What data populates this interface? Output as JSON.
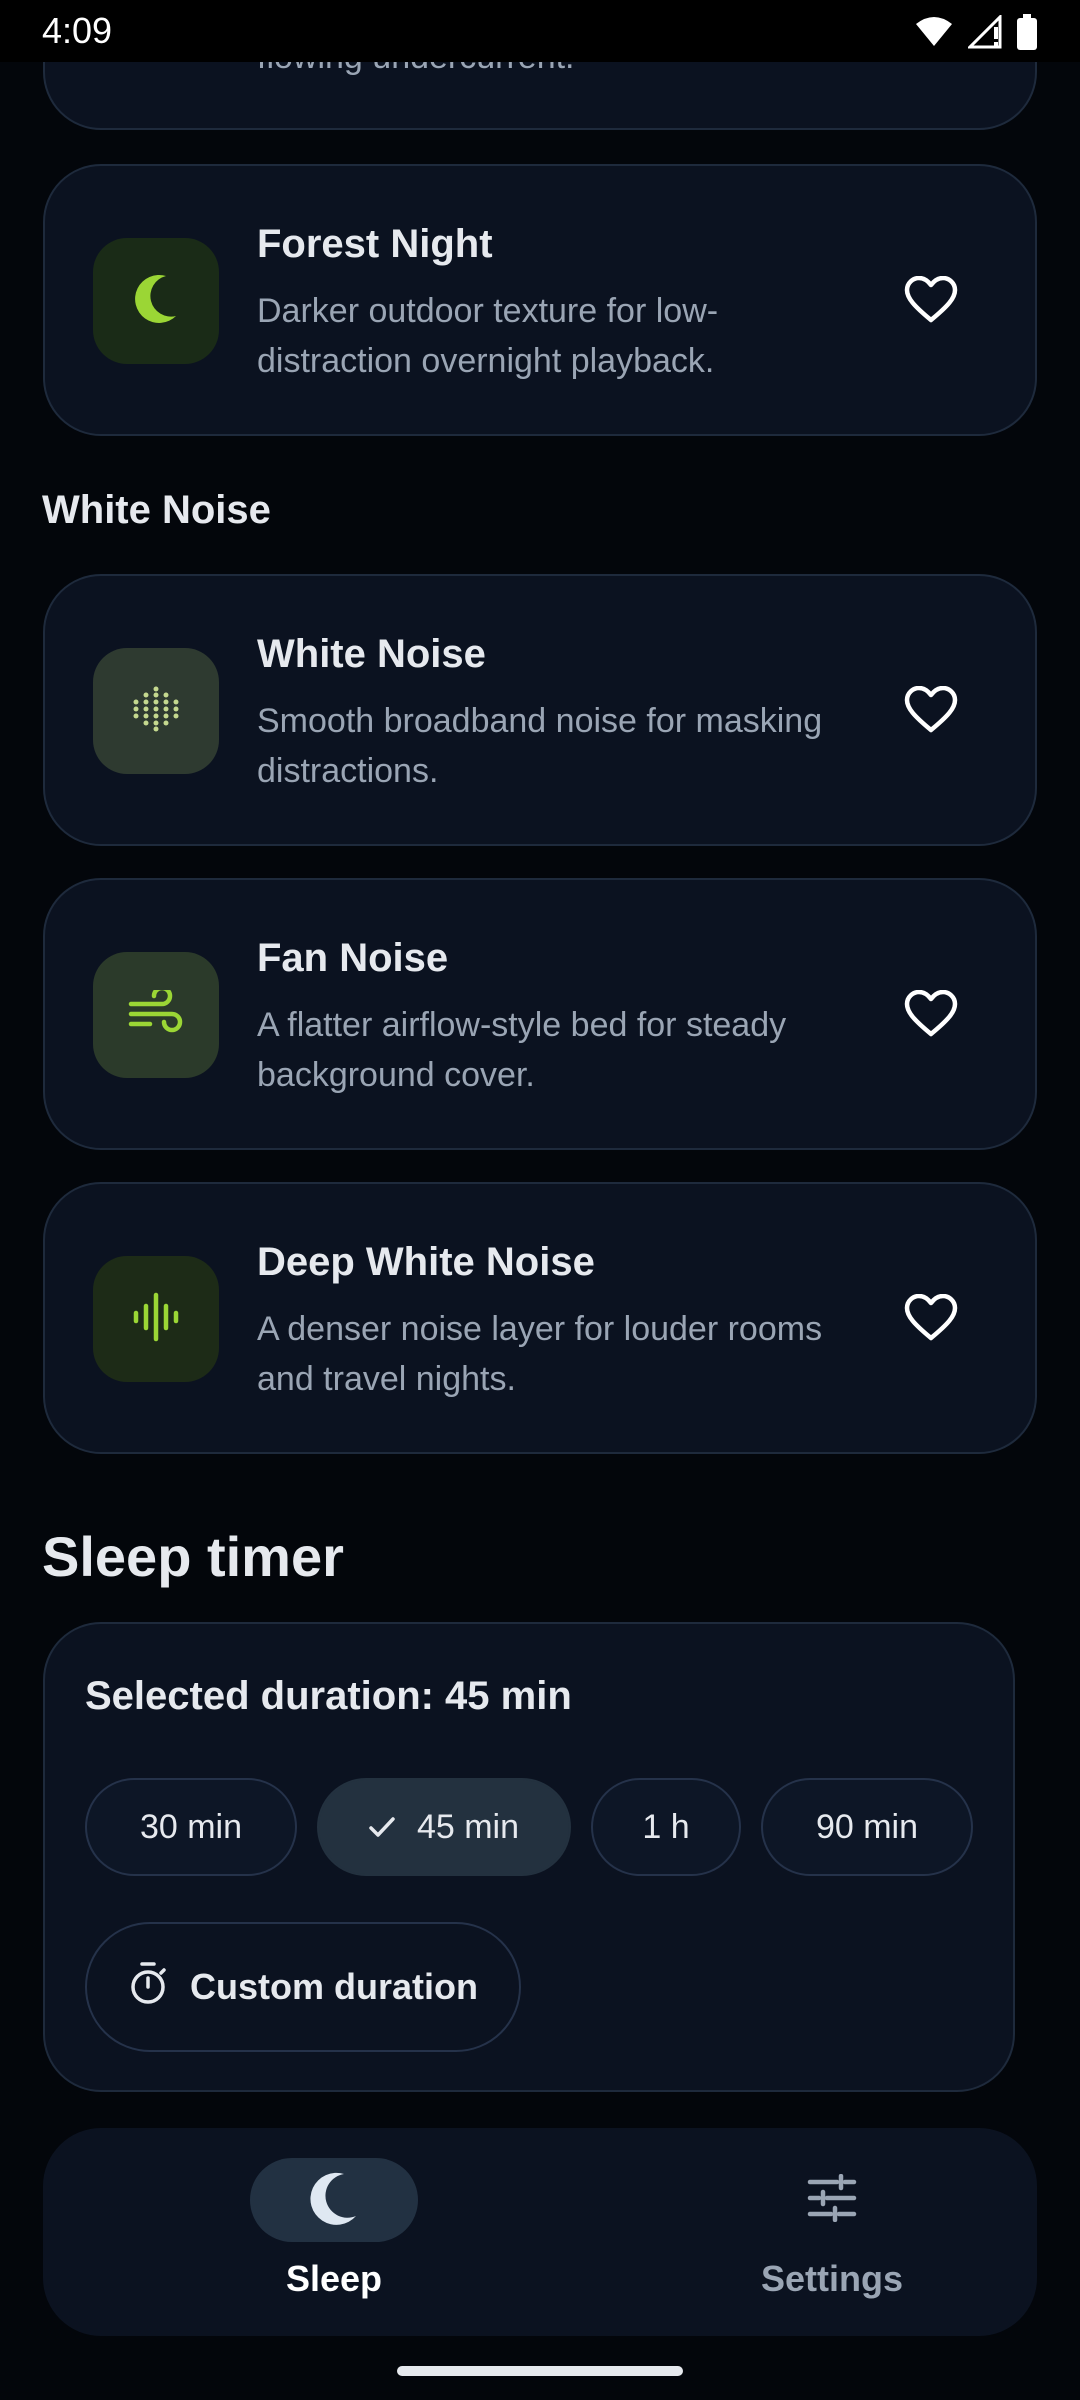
{
  "status_bar": {
    "time": "4:09"
  },
  "previous_card": {
    "desc_fragment": "flowing undercurrent."
  },
  "nature_cards": [
    {
      "title": "Forest Night",
      "desc": "Darker outdoor texture for low-distraction overnight playback.",
      "icon": "moon-icon",
      "favorite": false
    }
  ],
  "white_noise_section": {
    "label": "White Noise",
    "cards": [
      {
        "title": "White Noise",
        "desc": "Smooth broadband noise for masking distractions.",
        "icon": "dots-grid-icon",
        "favorite": false
      },
      {
        "title": "Fan Noise",
        "desc": "A flatter airflow-style bed for steady background cover.",
        "icon": "wind-icon",
        "favorite": false
      },
      {
        "title": "Deep White Noise",
        "desc": "A denser noise layer for louder rooms and travel nights.",
        "icon": "waveform-icon",
        "favorite": false
      }
    ]
  },
  "sleep_timer": {
    "title": "Sleep timer",
    "selected_label": "Selected duration: 45 min",
    "chips": [
      {
        "label": "30 min",
        "selected": false
      },
      {
        "label": "45 min",
        "selected": true
      },
      {
        "label": "1 h",
        "selected": false
      },
      {
        "label": "90 min",
        "selected": false
      }
    ],
    "custom_label": "Custom duration"
  },
  "bottom_nav": {
    "items": [
      {
        "label": "Sleep",
        "icon": "moon-icon",
        "active": true
      },
      {
        "label": "Settings",
        "icon": "sliders-icon",
        "active": false
      }
    ]
  },
  "colors": {
    "accent_green": "#9bd635",
    "card_bg": "#0b1220",
    "background": "#03060b"
  }
}
